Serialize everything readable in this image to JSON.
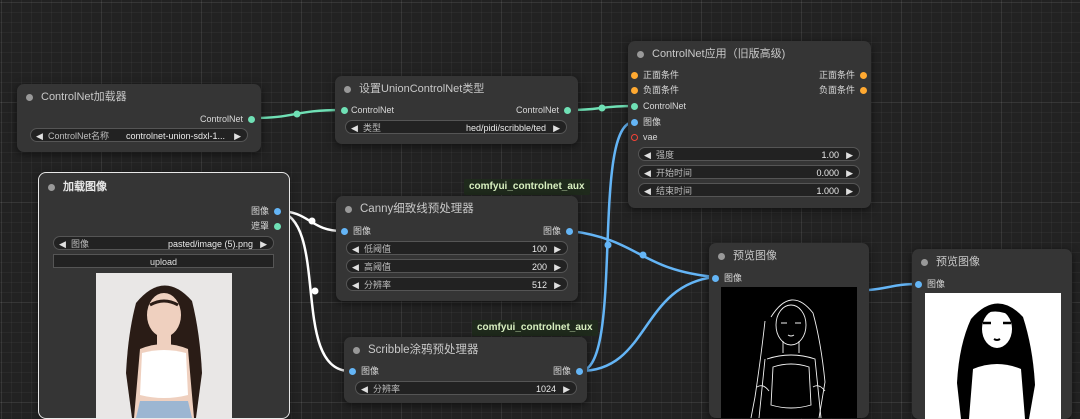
{
  "nodes": {
    "controlnet_loader": {
      "title": "ControlNet加载器",
      "output_label": "ControlNet",
      "widget_label": "ControlNet名称",
      "widget_value": "controlnet-union-sdxl-1..."
    },
    "union_type": {
      "title": "设置UnionControlNet类型",
      "input_label": "ControlNet",
      "output_label": "ControlNet",
      "widget_label": "类型",
      "widget_value": "hed/pidi/scribble/ted"
    },
    "apply": {
      "title": "ControlNet应用（旧版高级)",
      "inputs": [
        "正面条件",
        "负面条件",
        "ControlNet",
        "图像",
        "vae"
      ],
      "outputs": [
        "正面条件",
        "负面条件"
      ],
      "widgets": [
        {
          "label": "强度",
          "value": "1.00"
        },
        {
          "label": "开始时间",
          "value": "0.000"
        },
        {
          "label": "结束时间",
          "value": "1.000"
        }
      ]
    },
    "load_image": {
      "title": "加载图像",
      "outputs": [
        "图像",
        "遮罩"
      ],
      "widget_label": "图像",
      "widget_value": "pasted/image (5).png",
      "upload_label": "upload"
    },
    "canny": {
      "badge": "comfyui_controlnet_aux",
      "title": "Canny细致线预处理器",
      "input_label": "图像",
      "output_label": "图像",
      "widgets": [
        {
          "label": "低阈值",
          "value": "100"
        },
        {
          "label": "高阈值",
          "value": "200"
        },
        {
          "label": "分辨率",
          "value": "512"
        }
      ]
    },
    "scribble": {
      "badge": "comfyui_controlnet_aux",
      "title": "Scribble涂鸦预处理器",
      "input_label": "图像",
      "output_label": "图像",
      "widget_label": "分辨率",
      "widget_value": "1024"
    },
    "preview1": {
      "title": "预览图像",
      "input_label": "图像"
    },
    "preview2": {
      "title": "预览图像",
      "input_label": "图像"
    }
  },
  "arrows": {
    "left": "◀",
    "right": "▶"
  },
  "colors": {
    "canvas": "#222222",
    "node_bg": "#353535",
    "image_socket": "#64b5f6",
    "controlnet_socket": "#6fe0b5",
    "conditioning_socket": "#ffa931",
    "vae_socket": "#f44336",
    "badge_text": "#d8f0c0"
  }
}
